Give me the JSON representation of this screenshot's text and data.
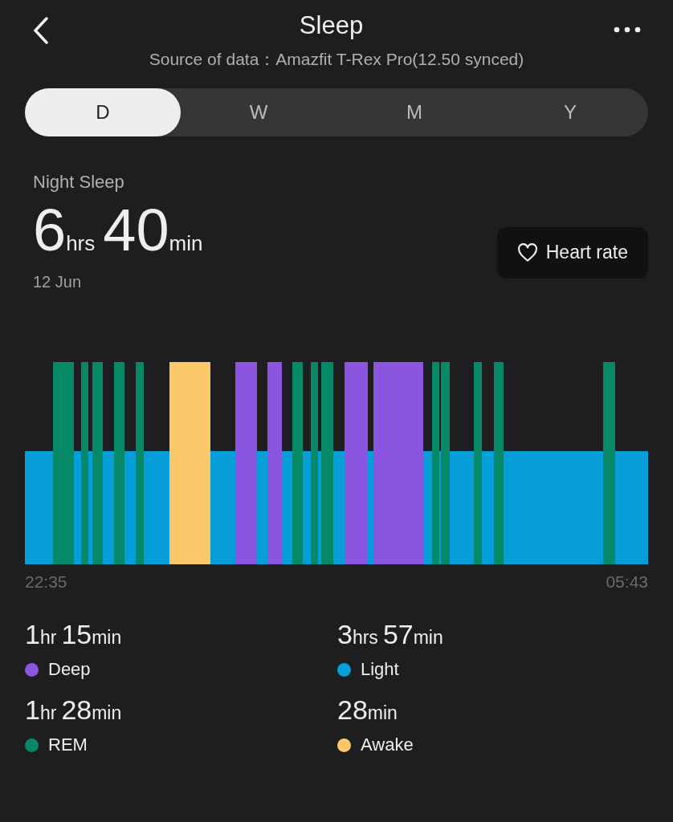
{
  "header": {
    "title": "Sleep",
    "subtitle": "Source of data：Amazfit T-Rex Pro(12.50 synced)"
  },
  "tabs": [
    {
      "label": "D",
      "selected": true
    },
    {
      "label": "W",
      "selected": false
    },
    {
      "label": "M",
      "selected": false
    },
    {
      "label": "Y",
      "selected": false
    }
  ],
  "summary": {
    "label": "Night Sleep",
    "duration": [
      {
        "num": "6",
        "unit": "hrs"
      },
      {
        "num": "40",
        "unit": "min"
      }
    ],
    "date": "12 Jun",
    "button": "Heart rate"
  },
  "chart": {
    "start": "22:35",
    "end": "05:43"
  },
  "stats": [
    {
      "duration": [
        {
          "num": "1",
          "unit": "hr"
        },
        {
          "num": "15",
          "unit": "min"
        }
      ],
      "label": "Deep",
      "color": "#8a55e0"
    },
    {
      "duration": [
        {
          "num": "3",
          "unit": "hrs"
        },
        {
          "num": "57",
          "unit": "min"
        }
      ],
      "label": "Light",
      "color": "#069ed9"
    },
    {
      "duration": [
        {
          "num": "1",
          "unit": "hr"
        },
        {
          "num": "28",
          "unit": "min"
        }
      ],
      "label": "REM",
      "color": "#078866"
    },
    {
      "duration": [
        {
          "num": "28",
          "unit": "min"
        }
      ],
      "label": "Awake",
      "color": "#fbc96a"
    }
  ]
}
